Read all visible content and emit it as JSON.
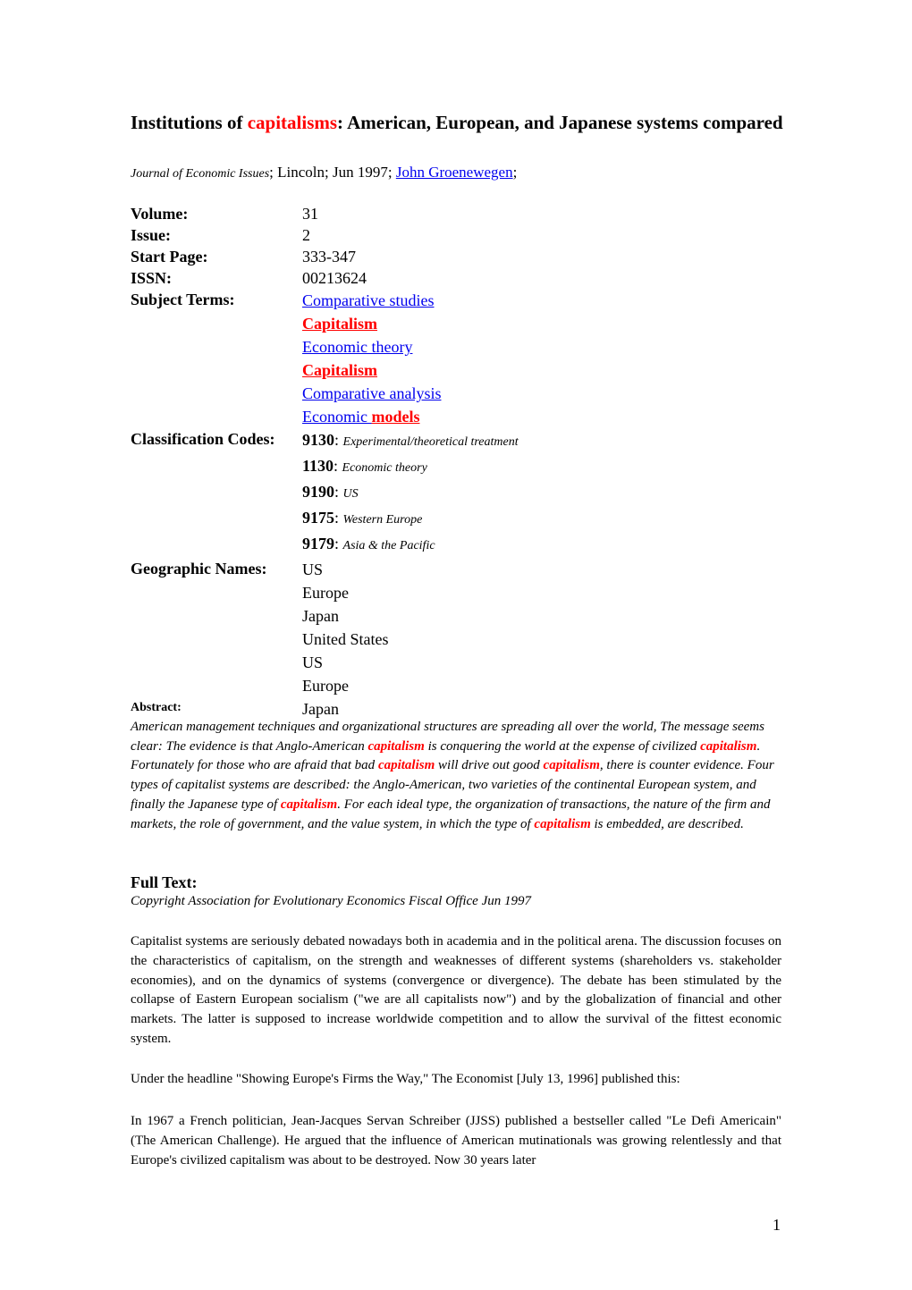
{
  "document": {
    "title": {
      "prefix": "Institutions of ",
      "highlight": "capitalisms",
      "suffix": ": American, European, and Japanese systems compared"
    },
    "byline": {
      "journal": "Journal of Economic Issues",
      "sep1": "; Lincoln; Jun 1997; ",
      "author": "John Groenewegen",
      "sep2": ";"
    },
    "metadata": {
      "volume_label": "Volume:",
      "volume": "31",
      "issue_label": "Issue:",
      "issue": "2",
      "start_page_label": "Start Page:",
      "start_page": "333-347",
      "issn_label": "ISSN:",
      "issn": "00213624",
      "subject_terms_label": "Subject Terms:",
      "subject_terms": [
        {
          "text": "Comparative studies",
          "highlight": false
        },
        {
          "text": "Capitalism",
          "highlight": true
        },
        {
          "text": "Economic theory",
          "highlight": false
        },
        {
          "text": "Capitalism",
          "highlight": true
        },
        {
          "text": "Comparative analysis",
          "highlight": false
        },
        {
          "text": "Economic ",
          "highlight_suffix": "models"
        }
      ],
      "classification_codes_label": "Classification Codes:",
      "classification_codes": [
        {
          "code": "9130",
          "desc": "Experimental/theoretical treatment"
        },
        {
          "code": "1130",
          "desc": "Economic theory"
        },
        {
          "code": "9190",
          "desc": "US"
        },
        {
          "code": "9175",
          "desc": "Western Europe"
        },
        {
          "code": "9179",
          "desc": "Asia & the Pacific"
        }
      ],
      "geographic_names_label": "Geographic Names:",
      "geographic_names": [
        "US",
        "Europe",
        "Japan",
        "United States",
        "US",
        "Europe",
        "Japan"
      ]
    },
    "abstract": {
      "label": "Abstract:",
      "segments": [
        {
          "t": "American management techniques and organizational structures are spreading all over the world, The message seems clear: The evidence is that Anglo-American "
        },
        {
          "t": "capitalism",
          "hl": true
        },
        {
          "t": " is conquering the world at the expense of civilized "
        },
        {
          "t": "capitalism",
          "hl": true
        },
        {
          "t": ". Fortunately for those who are afraid that bad "
        },
        {
          "t": "capitalism",
          "hl": true
        },
        {
          "t": " will drive out good "
        },
        {
          "t": "capitalism",
          "hl": true
        },
        {
          "t": ", there is counter evidence. Four types of capitalist systems are described: the Anglo-American, two varieties of the continental European system, and finally the Japanese type of "
        },
        {
          "t": "capitalism",
          "hl": true
        },
        {
          "t": ". For each ideal type, the organization of transactions, the nature of the firm and markets, the role of government, and the value system, in which the type of "
        },
        {
          "t": "capitalism",
          "hl": true
        },
        {
          "t": " is embedded, are described."
        }
      ]
    },
    "full_text": {
      "label": "Full Text:",
      "copyright": "Copyright Association for Evolutionary Economics Fiscal Office Jun 1997",
      "paragraphs": [
        "Capitalist systems are seriously debated nowadays both in academia and in the political arena. The discussion focuses on the characteristics of capitalism, on the strength and weaknesses of different systems (shareholders vs. stakeholder economies), and on the dynamics of systems (convergence or divergence). The debate has been stimulated by the collapse of Eastern European socialism (\"we are all capitalists now\") and by the globalization of financial and other markets. The latter is supposed to increase worldwide competition and to allow the survival of the fittest economic system.",
        "Under the headline \"Showing Europe's Firms the Way,\" The Economist [July 13, 1996] published this:",
        "In 1967 a French politician, Jean-Jacques Servan Schreiber (JJSS) published a bestseller called \"Le Defi Americain\" (The American Challenge). He argued that the influence of American mutinationals was growing relentlessly and that Europe's civilized capitalism was about to be destroyed. Now 30 years later"
      ]
    },
    "page_number": "1",
    "colors": {
      "highlight": "#ff0000",
      "link": "#0000ee",
      "text": "#000000"
    }
  }
}
